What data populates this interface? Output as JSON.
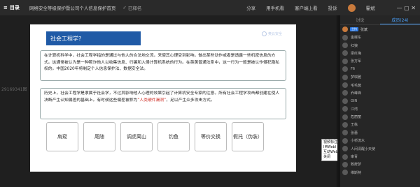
{
  "topbar": {
    "menu_label": "目录",
    "menu_icon": "≡",
    "doc_title": "网络安全等级保护暨公司个人信息保护首页",
    "saved_label": "已释名",
    "actions": [
      "分享",
      "用手机看",
      "客户端上看",
      "投诉"
    ],
    "username": "霍斌",
    "window_controls": "— ▢ ✕"
  },
  "page_number": "29169341图",
  "slide": {
    "title": "社会工程学?",
    "logo_text": "奥云安全",
    "box1": "在计算机科学中，社会工程学指的是通过与他人的合法地交流，来使其心理受到影响，做出某些动作或者是透露一些机密信息的方式。这通常被认为是一种欺诈他人以收集信息、行骗和入侵计算机系统的行为。在英美普通法系中，这一行为一般是被认作侵犯隐私权的。中国2020年将制定个人信息保护法、数据安全法。",
    "box2_before": "历史上，社会工程学是隶属于社会学，不过其影响他人心理的效果引起了计算机安全专家的注意。所有社会工程学攻击都创建在使人决断产生认知偏差的基础上。有时候这些偏差被称为",
    "box2_highlight": "“人类硬件漏洞”",
    "box2_after": "，足以产生众多攻击方式。",
    "tags": [
      "肩窥",
      "尾随",
      "调虎离山",
      "钓鱼",
      "等价交换",
      "假托（伪装）"
    ]
  },
  "context_menu": [
    "视频标注",
    "IMWebl",
    "互动Web",
    "关闭"
  ],
  "panel": {
    "tabs": [
      "讨论",
      "成员(24)"
    ],
    "me_badge": "主持",
    "me_name": "张斌",
    "members": [
      "金蝶东",
      "红狼",
      "梁红梅",
      "张方军",
      "F6",
      "梦琪雅",
      "毛毛酱",
      "乔峰锋",
      "GIN",
      "江湾",
      "危丽丽",
      "王栋",
      "张蕾",
      "小桥流水",
      "人间清醒小天使",
      "审青",
      "致辞梦",
      "维斯特"
    ]
  },
  "colors": {
    "accent": "#2f7be5",
    "slide_title": "#1f5aa6",
    "highlight": "#d0342c"
  }
}
